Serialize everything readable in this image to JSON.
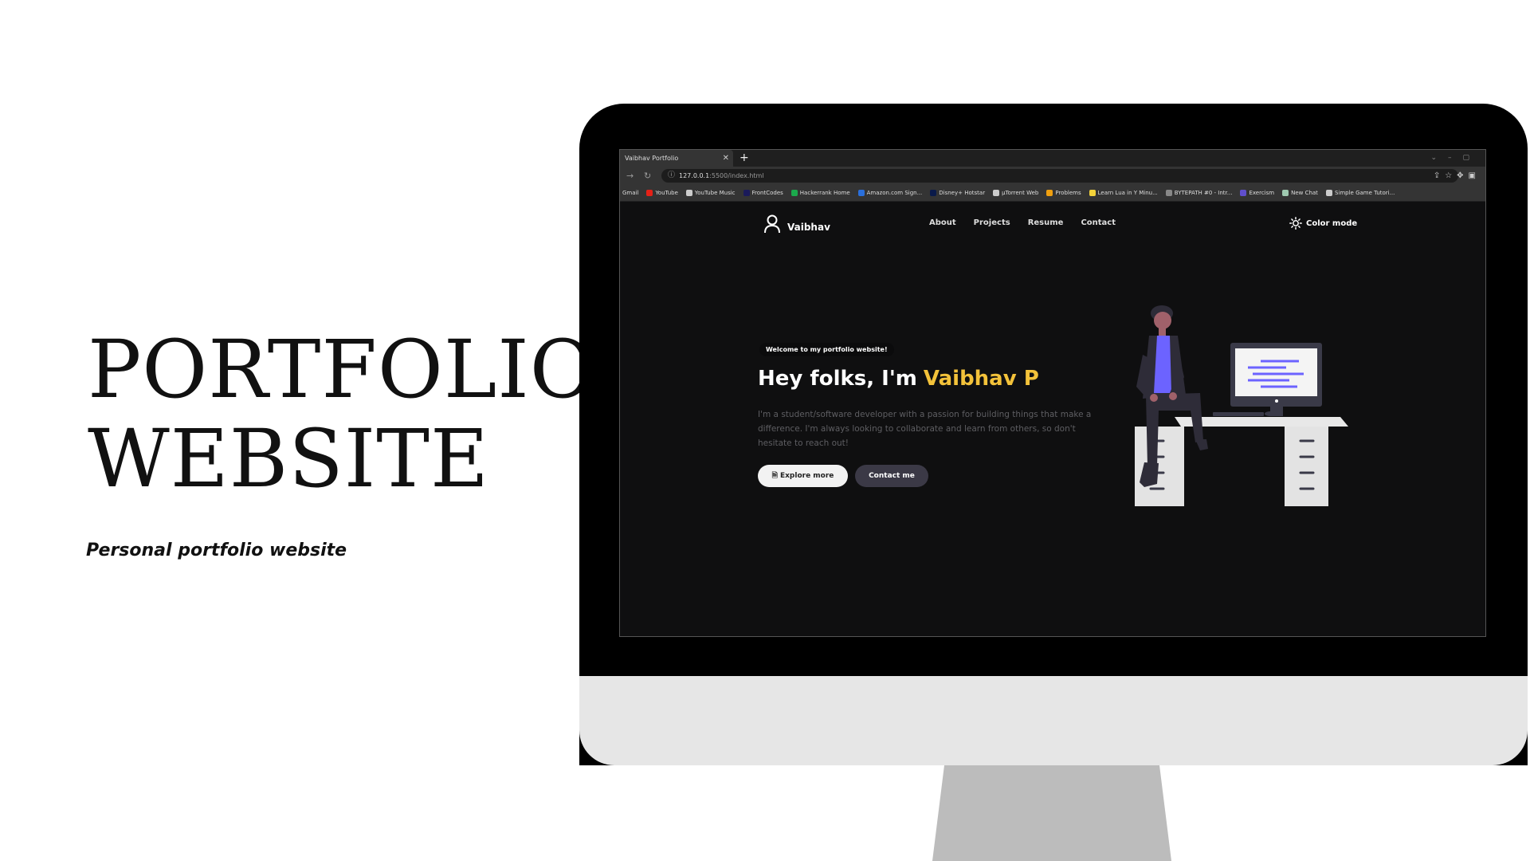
{
  "slide": {
    "title_line1": "PORTFOLIO",
    "title_line2": "WEBSITE",
    "subtitle": "Personal portfolio website"
  },
  "browser": {
    "tab_title": "Vaibhav Portfolio",
    "tab_close": "✕",
    "new_tab": "+",
    "url_host": "127.0.0.1",
    "url_path": ":5500/index.html",
    "bookmarks": [
      {
        "label": "Gmail",
        "color": "#343434"
      },
      {
        "label": "YouTube",
        "color": "#e62117"
      },
      {
        "label": "YouTube Music",
        "color": "#cccccc"
      },
      {
        "label": "FrontCodes",
        "color": "#1a1a5a"
      },
      {
        "label": "Hackerrank Home",
        "color": "#1ba94c"
      },
      {
        "label": "Amazon.com Sign...",
        "color": "#2a6fdb"
      },
      {
        "label": "Disney+ Hotstar",
        "color": "#0a1a4a"
      },
      {
        "label": "µTorrent Web",
        "color": "#cccccc"
      },
      {
        "label": "Problems",
        "color": "#f0a010"
      },
      {
        "label": "Learn Lua in Y Minu...",
        "color": "#f3d23a"
      },
      {
        "label": "BYTEPATH #0 - Intr...",
        "color": "#888888"
      },
      {
        "label": "Exercism",
        "color": "#604fcd"
      },
      {
        "label": "New Chat",
        "color": "#9fc9b0"
      },
      {
        "label": "Simple Game Tutori...",
        "color": "#cccccc"
      }
    ]
  },
  "site": {
    "brand": "Vaibhav",
    "nav": [
      "About",
      "Projects",
      "Resume",
      "Contact"
    ],
    "color_mode": "Color mode",
    "welcome": "Welcome to my portfolio website!",
    "headline": "Hey folks, I'm",
    "name": "Vaibhav P",
    "description": "I'm a student/software developer with a passion for building things that make a difference. I'm always looking to collaborate and learn from others, so don't hesitate to reach out!",
    "explore_btn": "🗎 Explore more",
    "contact_btn": "Contact me",
    "accent_color": "#f3c23a"
  }
}
